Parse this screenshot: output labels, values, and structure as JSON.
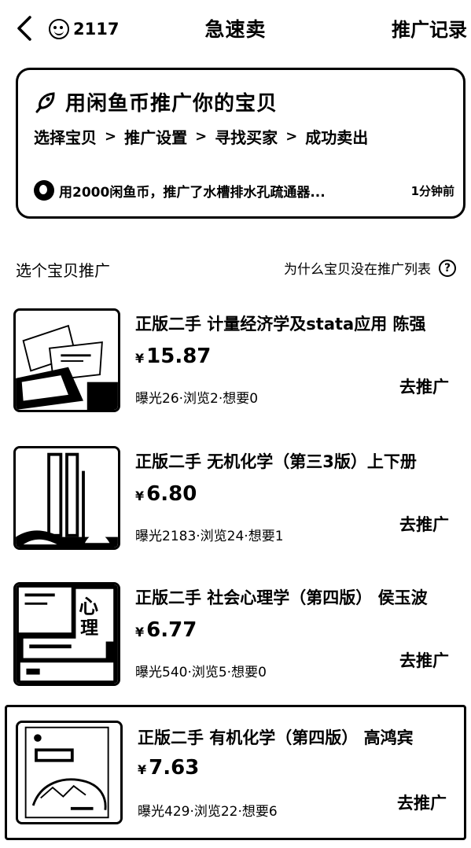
{
  "header": {
    "coin_count": "2117",
    "title": "急速卖",
    "records_label": "推广记录"
  },
  "banner": {
    "title": "用闲鱼币推广你的宝贝",
    "steps": [
      "选择宝贝",
      "推广设置",
      "寻找买家",
      "成功卖出"
    ],
    "activity_text": "用2000闲鱼币，推广了水槽排水孔疏通器...",
    "activity_time": "1分钟前"
  },
  "section": {
    "title": "选个宝贝推广",
    "help_text": "为什么宝贝没在推广列表"
  },
  "items": [
    {
      "name": "正版二手 计量经济学及stata应用 陈强",
      "price": "15.87",
      "stats": "曝光26·浏览2·想要0",
      "action": "去推广"
    },
    {
      "name": "正版二手 无机化学（第三3版）上下册",
      "price": "6.80",
      "stats": "曝光2183·浏览24·想要1",
      "action": "去推广"
    },
    {
      "name": "正版二手 社会心理学（第四版） 侯玉波",
      "price": "6.77",
      "stats": "曝光540·浏览5·想要0",
      "action": "去推广"
    },
    {
      "name": "正版二手 有机化学（第四版） 高鸿宾",
      "price": "7.63",
      "stats": "曝光429·浏览22·想要6",
      "action": "去推广"
    }
  ],
  "currency_symbol": "¥",
  "colors": {
    "ink": "#000000",
    "background": "#ffffff"
  }
}
